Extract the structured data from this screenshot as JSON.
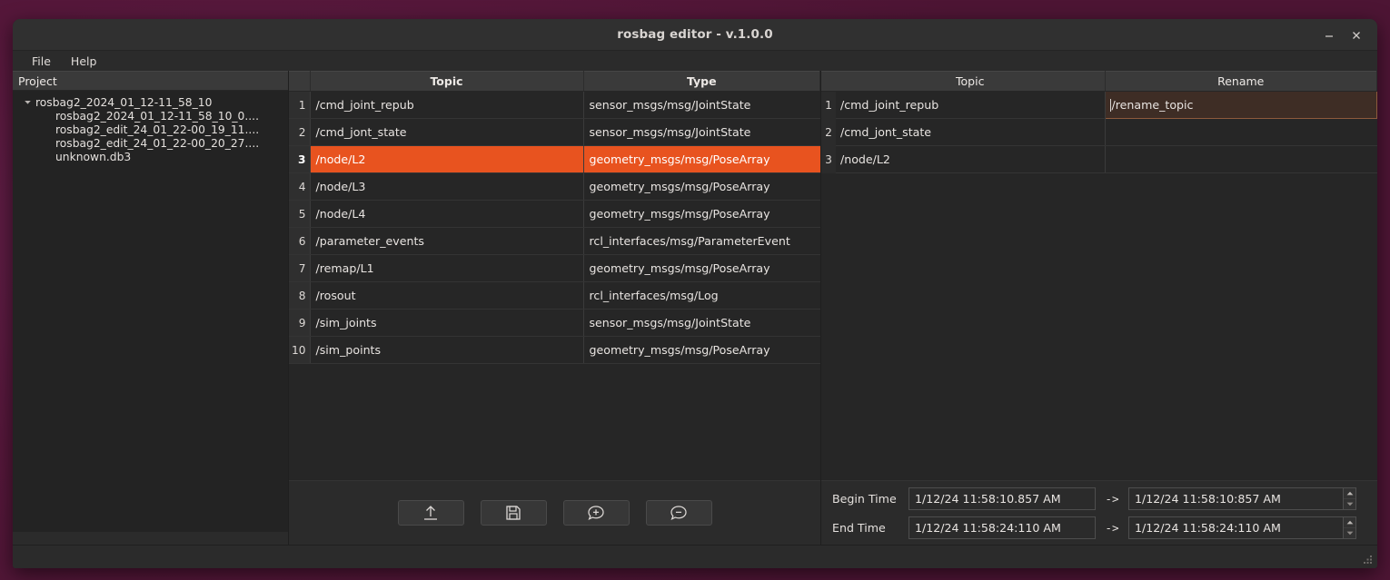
{
  "window": {
    "title": "rosbag editor - v.1.0.0",
    "minimize_label": "–",
    "close_label": "×"
  },
  "menubar": {
    "items": [
      {
        "label": "File"
      },
      {
        "label": "Help"
      }
    ]
  },
  "project_tree": {
    "header": "Project",
    "root": {
      "label": "rosbag2_2024_01_12-11_58_10",
      "expanded": true
    },
    "children": [
      {
        "label": "rosbag2_2024_01_12-11_58_10_0...."
      },
      {
        "label": "rosbag2_edit_24_01_22-00_19_11...."
      },
      {
        "label": "rosbag2_edit_24_01_22-00_20_27...."
      },
      {
        "label": "unknown.db3"
      }
    ]
  },
  "topics_table": {
    "columns": [
      "Topic",
      "Type"
    ],
    "rows": [
      {
        "n": "1",
        "topic": "/cmd_joint_repub",
        "type": "sensor_msgs/msg/JointState",
        "selected": false
      },
      {
        "n": "2",
        "topic": "/cmd_jont_state",
        "type": "sensor_msgs/msg/JointState",
        "selected": false
      },
      {
        "n": "3",
        "topic": "/node/L2",
        "type": "geometry_msgs/msg/PoseArray",
        "selected": true
      },
      {
        "n": "4",
        "topic": "/node/L3",
        "type": "geometry_msgs/msg/PoseArray",
        "selected": false
      },
      {
        "n": "5",
        "topic": "/node/L4",
        "type": "geometry_msgs/msg/PoseArray",
        "selected": false
      },
      {
        "n": "6",
        "topic": "/parameter_events",
        "type": "rcl_interfaces/msg/ParameterEvent",
        "selected": false
      },
      {
        "n": "7",
        "topic": "/remap/L1",
        "type": "geometry_msgs/msg/PoseArray",
        "selected": false
      },
      {
        "n": "8",
        "topic": "/rosout",
        "type": "rcl_interfaces/msg/Log",
        "selected": false
      },
      {
        "n": "9",
        "topic": "/sim_joints",
        "type": "sensor_msgs/msg/JointState",
        "selected": false
      },
      {
        "n": "10",
        "topic": "/sim_points",
        "type": "geometry_msgs/msg/PoseArray",
        "selected": false
      }
    ]
  },
  "toolbar": {
    "buttons": [
      {
        "icon": "upload-icon",
        "title": "Load bag"
      },
      {
        "icon": "save-icon",
        "title": "Save bag"
      },
      {
        "icon": "add-topic-icon",
        "title": "Add topic"
      },
      {
        "icon": "remove-topic-icon",
        "title": "Remove topic"
      }
    ]
  },
  "selected_table": {
    "columns": [
      "Topic",
      "Rename"
    ],
    "rows": [
      {
        "n": "1",
        "topic": "/cmd_joint_repub",
        "rename": "/rename_topic",
        "editing": true
      },
      {
        "n": "2",
        "topic": "/cmd_jont_state",
        "rename": "",
        "editing": false
      },
      {
        "n": "3",
        "topic": "/node/L2",
        "rename": "",
        "editing": false
      }
    ]
  },
  "time_range": {
    "arrow": "->",
    "begin": {
      "label": "Begin Time",
      "source": "1/12/24 11:58:10.857 AM",
      "target": "1/12/24 11:58:10:857 AM"
    },
    "end": {
      "label": "End Time",
      "source": "1/12/24 11:58:24:110 AM",
      "target": "1/12/24 11:58:24:110 AM"
    }
  },
  "colors": {
    "accent_orange": "#e8531f",
    "editing_bg": "#3e2d25",
    "editing_border": "#8c5a3c",
    "window_bg": "#2b2b2b",
    "header_bg": "#3a3a3a",
    "desktop_bg": "#5c1a3e"
  }
}
